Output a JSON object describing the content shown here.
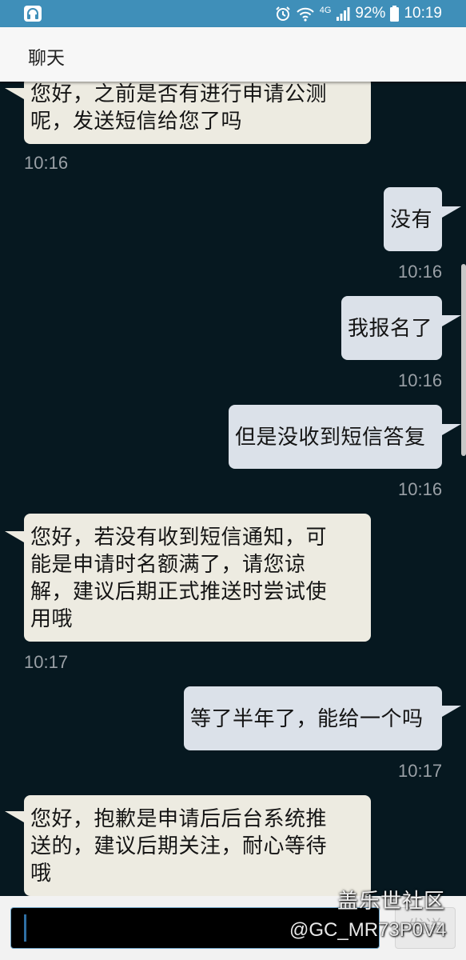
{
  "status_bar": {
    "network": "4G",
    "battery": "92%",
    "time": "10:19"
  },
  "header": {
    "title": "聊天"
  },
  "messages": [
    {
      "side": "in",
      "lines": [
        "您好，之前是否有进行申请公测",
        "呢，发送短信给您了吗"
      ],
      "time": "10:16"
    },
    {
      "side": "out",
      "lines": [
        "没有"
      ],
      "time": "10:16"
    },
    {
      "side": "out",
      "lines": [
        "我报名了"
      ],
      "time": "10:16"
    },
    {
      "side": "out",
      "lines": [
        "但是没收到短信答复"
      ],
      "time": "10:16"
    },
    {
      "side": "in",
      "lines": [
        "您好，若没有收到短信通知，可",
        "能是申请时名额满了，请您谅",
        "解，建议后期正式推送时尝试使",
        "用哦"
      ],
      "time": "10:17"
    },
    {
      "side": "out",
      "lines": [
        "等了半年了，能给一个吗"
      ],
      "time": "10:17"
    },
    {
      "side": "in",
      "lines": [
        "您好，抱歉是申请后后台系统推",
        "送的，建议后期关注，耐心等待",
        "哦"
      ],
      "time": ""
    }
  ],
  "input": {
    "value": "",
    "send_label": "发送"
  },
  "watermark": {
    "site": "盖乐世社区",
    "user": "@GC_MR73P0V4"
  },
  "colors": {
    "status_bar": "#3f8fb9",
    "chat_background": "#061820",
    "incoming_bubble": "#edebe1",
    "outgoing_bubble": "#dbe1e9"
  }
}
